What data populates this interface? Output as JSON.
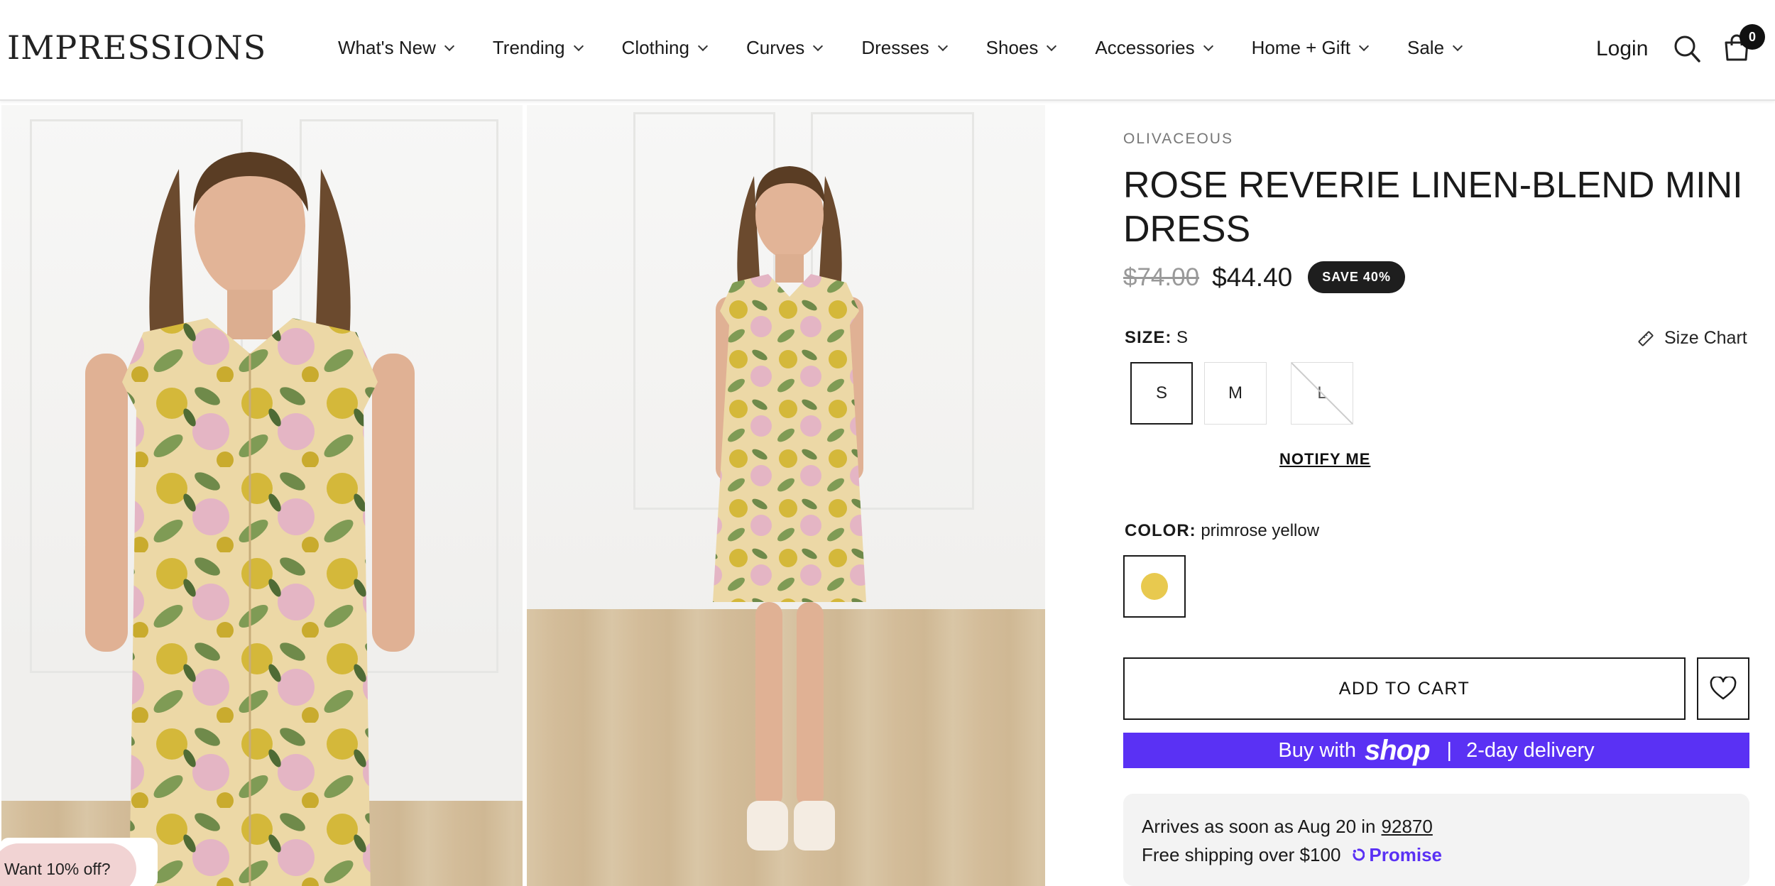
{
  "header": {
    "logo": "IMPRESSIONS",
    "nav": [
      "What's New",
      "Trending",
      "Clothing",
      "Curves",
      "Dresses",
      "Shoes",
      "Accessories",
      "Home + Gift",
      "Sale"
    ],
    "login": "Login",
    "cart_count": "0"
  },
  "product": {
    "brand": "OLIVACEOUS",
    "title": "ROSE REVERIE LINEN-BLEND MINI DRESS",
    "compare_price": "$74.00",
    "price": "$44.40",
    "save_badge": "SAVE 40%",
    "size_label": "SIZE:",
    "size_selected": "S",
    "size_chart": "Size Chart",
    "sizes": [
      "S",
      "M",
      "L"
    ],
    "notify_me": "NOTIFY ME",
    "color_label": "COLOR:",
    "color_selected": "primrose yellow",
    "swatch_color": "#e8c94f",
    "add_to_cart": "ADD TO CART",
    "shop_pay": {
      "buy_with": "Buy with",
      "shop": "shop",
      "separator": "|",
      "delivery": "2-day delivery"
    },
    "shipping": {
      "arrives_prefix": "Arrives as soon as Aug 20 in",
      "zip": "92870",
      "free_shipping": "Free shipping over $100",
      "promise": "Promise"
    }
  },
  "promo": {
    "label": "Want 10% off?"
  },
  "colors": {
    "accent": "#5a31f4",
    "badge": "#1e1e1e",
    "promo_bg": "#f1d3d3"
  }
}
